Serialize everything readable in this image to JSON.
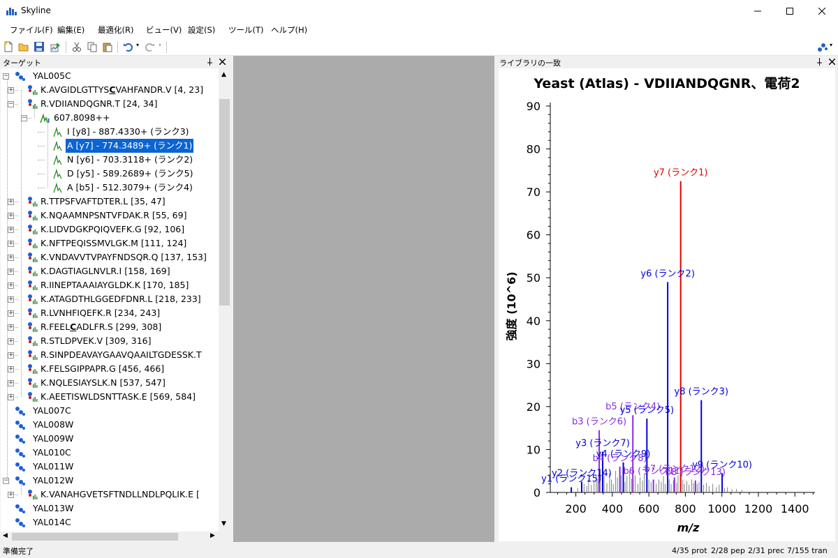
{
  "window": {
    "title": "Skyline",
    "minimize": "—",
    "maximize": "☐",
    "close": "✕"
  },
  "menu": [
    "ファイル(F)",
    "編集(E)",
    "最適化(R)",
    "ビュー(V)",
    "設定(S)",
    "ツール(T)",
    "ヘルプ(H)"
  ],
  "toolbar": {
    "icons": [
      "new-file-icon",
      "open-folder-icon",
      "save-icon",
      "import-icon",
      "cut-icon",
      "copy-icon",
      "paste-icon",
      "undo-icon",
      "redo-icon"
    ]
  },
  "targets_panel": {
    "title": "ターゲット",
    "pin": "ꟷ",
    "close": "✕"
  },
  "tree": [
    {
      "type": "protein",
      "text": "YAL005C",
      "expanded": true
    },
    {
      "type": "peptide",
      "pre": "K.AVGIDLGTTYS",
      "bold": "C",
      "post": "VAHFANDR.V [4, 23]",
      "expanded": false
    },
    {
      "type": "peptide",
      "pre": "R.VDIIANDQGNR.T [24, 34]",
      "bold": "",
      "post": "",
      "expanded": true
    },
    {
      "type": "precursor",
      "text": "607.8098++",
      "expanded": true
    },
    {
      "type": "transition",
      "text": "I [y8] - 887.4330+ (ランク3)"
    },
    {
      "type": "transition",
      "text": "A [y7] - 774.3489+ (ランク1)",
      "selected": true
    },
    {
      "type": "transition",
      "text": "N [y6] - 703.3118+ (ランク2)"
    },
    {
      "type": "transition",
      "text": "D [y5] - 589.2689+ (ランク5)"
    },
    {
      "type": "transition",
      "text": "A [b5] - 512.3079+ (ランク4)"
    },
    {
      "type": "peptide",
      "pre": "R.TTPSFVAFTDTER.L [35, 47]",
      "bold": "",
      "post": ""
    },
    {
      "type": "peptide",
      "pre": "K.NQAAMNPSNTVFDAK.R [55, 69]",
      "bold": "",
      "post": ""
    },
    {
      "type": "peptide",
      "pre": "K.LIDVDGKPQIQVEFK.G [92, 106]",
      "bold": "",
      "post": ""
    },
    {
      "type": "peptide",
      "pre": "K.NFTPEQISSMVLGK.M [111, 124]",
      "bold": "",
      "post": ""
    },
    {
      "type": "peptide",
      "pre": "K.VNDAVVTVPAYFNDSQR.Q [137, 153]",
      "bold": "",
      "post": ""
    },
    {
      "type": "peptide",
      "pre": "K.DAGTIAGLNVLR.I [158, 169]",
      "bold": "",
      "post": ""
    },
    {
      "type": "peptide",
      "pre": "R.IINEPTAAAIAYGLDK.K [170, 185]",
      "bold": "",
      "post": ""
    },
    {
      "type": "peptide",
      "pre": "K.ATAGDTHLGGEDFDNR.L [218, 233]",
      "bold": "",
      "post": ""
    },
    {
      "type": "peptide",
      "pre": "R.LVNHFIQEFK.R [234, 243]",
      "bold": "",
      "post": ""
    },
    {
      "type": "peptide",
      "pre": "R.FEEL",
      "bold": "C",
      "post": "ADLFR.S [299, 308]"
    },
    {
      "type": "peptide",
      "pre": "R.STLDPVEK.V [309, 316]",
      "bold": "",
      "post": ""
    },
    {
      "type": "peptide",
      "pre": "R.SINPDEAVAYGAAVQAAILTGDESSK.T",
      "bold": "",
      "post": ""
    },
    {
      "type": "peptide",
      "pre": "K.FELSGIPPAPR.G [456, 466]",
      "bold": "",
      "post": ""
    },
    {
      "type": "peptide",
      "pre": "K.NQLESIAYSLK.N [537, 547]",
      "bold": "",
      "post": ""
    },
    {
      "type": "peptide",
      "pre": "K.AEETISWLDSNTTASK.E [569, 584]",
      "bold": "",
      "post": ""
    },
    {
      "type": "protein",
      "text": "YAL007C"
    },
    {
      "type": "protein",
      "text": "YAL008W"
    },
    {
      "type": "protein",
      "text": "YAL009W"
    },
    {
      "type": "protein",
      "text": "YAL010C"
    },
    {
      "type": "protein",
      "text": "YAL011W"
    },
    {
      "type": "protein",
      "text": "YAL012W",
      "expanded": true
    },
    {
      "type": "peptide",
      "pre": "K.VANAHGVETSFTNDLLNDLPQLIK.E [",
      "bold": "",
      "post": ""
    },
    {
      "type": "protein",
      "text": "YAL013W"
    },
    {
      "type": "protein",
      "text": "YAL014C"
    }
  ],
  "library_panel": {
    "title": "ライブラリの一致",
    "pin": "ꟷ",
    "close": "✕"
  },
  "chart_data": {
    "type": "bar",
    "title": "Yeast (Atlas) - VDIIANDQGNR、電荷2",
    "xlabel": "m/z",
    "ylabel": "強度 (10^6)",
    "xlim": [
      60,
      1510
    ],
    "ylim": [
      0,
      90
    ],
    "xticks": [
      200,
      400,
      600,
      800,
      1000,
      1200,
      1400
    ],
    "yticks": [
      0,
      10,
      20,
      30,
      40,
      50,
      60,
      70,
      80,
      90
    ],
    "colors": {
      "selected": "#e00000",
      "y_ion": "#0000dd",
      "b_ion": "#8a2be2",
      "other": "#808080"
    },
    "peaks": [
      {
        "mz": 774.35,
        "intensity": 72.5,
        "label": "y7 (ランク1)",
        "kind": "selected"
      },
      {
        "mz": 703.31,
        "intensity": 49.0,
        "label": "y6 (ランク2)",
        "kind": "y_ion"
      },
      {
        "mz": 887.43,
        "intensity": 21.5,
        "label": "y8 (ランク3)",
        "kind": "y_ion"
      },
      {
        "mz": 512.31,
        "intensity": 18.0,
        "label": "b5 (ランク4)",
        "kind": "b_ion"
      },
      {
        "mz": 589.27,
        "intensity": 17.2,
        "label": "y5 (ランク5)",
        "kind": "y_ion"
      },
      {
        "mz": 328.0,
        "intensity": 14.5,
        "label": "b3 (ランク6)",
        "kind": "b_ion"
      },
      {
        "mz": 347.0,
        "intensity": 9.5,
        "label": "y3 (ランク7)",
        "kind": "y_ion"
      },
      {
        "mz": 441.0,
        "intensity": 6.0,
        "label": "b4 (ランク8)",
        "kind": "b_ion"
      },
      {
        "mz": 460.0,
        "intensity": 7.0,
        "label": "y4 (ランク9)",
        "kind": "y_ion"
      },
      {
        "mz": 1001.5,
        "intensity": 4.5,
        "label": "y9 (ランク10)",
        "kind": "y_ion"
      },
      {
        "mz": 625.0,
        "intensity": 3.0,
        "label": "b6 (ランク11)",
        "kind": "b_ion"
      },
      {
        "mz": 740.0,
        "intensity": 3.5,
        "label": "b7 (ランク12)",
        "kind": "b_ion"
      },
      {
        "mz": 855.0,
        "intensity": 2.8,
        "label": "b8 (ランク13)",
        "kind": "b_ion"
      },
      {
        "mz": 232.0,
        "intensity": 2.5,
        "label": "y2 (ランク14)",
        "kind": "y_ion"
      },
      {
        "mz": 175.1,
        "intensity": 1.2,
        "label": "y1 (ランク15)",
        "kind": "y_ion"
      }
    ],
    "noise": [
      [
        210,
        1.0
      ],
      [
        245,
        2.0
      ],
      [
        260,
        1.5
      ],
      [
        270,
        3.0
      ],
      [
        285,
        1.8
      ],
      [
        300,
        2.5
      ],
      [
        312,
        4.0
      ],
      [
        320,
        3.2
      ],
      [
        335,
        5.5
      ],
      [
        355,
        3.8
      ],
      [
        370,
        2.2
      ],
      [
        385,
        4.5
      ],
      [
        395,
        3.0
      ],
      [
        405,
        2.0
      ],
      [
        418,
        5.0
      ],
      [
        428,
        3.5
      ],
      [
        448,
        4.0
      ],
      [
        470,
        2.5
      ],
      [
        480,
        3.8
      ],
      [
        495,
        5.0
      ],
      [
        505,
        3.2
      ],
      [
        525,
        4.0
      ],
      [
        540,
        2.0
      ],
      [
        552,
        3.5
      ],
      [
        565,
        2.8
      ],
      [
        575,
        4.2
      ],
      [
        600,
        3.0
      ],
      [
        612,
        2.4
      ],
      [
        640,
        2.0
      ],
      [
        655,
        3.0
      ],
      [
        668,
        2.5
      ],
      [
        680,
        3.8
      ],
      [
        690,
        2.0
      ],
      [
        712,
        3.0
      ],
      [
        722,
        2.0
      ],
      [
        735,
        2.8
      ],
      [
        752,
        2.2
      ],
      [
        760,
        4.0
      ],
      [
        786,
        3.0
      ],
      [
        795,
        2.0
      ],
      [
        808,
        2.6
      ],
      [
        820,
        1.8
      ],
      [
        835,
        3.0
      ],
      [
        845,
        2.2
      ],
      [
        865,
        2.0
      ],
      [
        875,
        2.5
      ],
      [
        900,
        1.8
      ],
      [
        915,
        2.2
      ],
      [
        930,
        1.5
      ],
      [
        950,
        2.0
      ],
      [
        970,
        1.2
      ],
      [
        985,
        1.8
      ],
      [
        1015,
        1.0
      ],
      [
        1030,
        1.2
      ],
      [
        1055,
        0.8
      ],
      [
        1080,
        0.8
      ],
      [
        1110,
        0.6
      ]
    ]
  },
  "status": {
    "ready": "準備完了",
    "counts": [
      "4/35 prot",
      "2/28 pep",
      "2/31 prec",
      "7/155 tran"
    ]
  }
}
